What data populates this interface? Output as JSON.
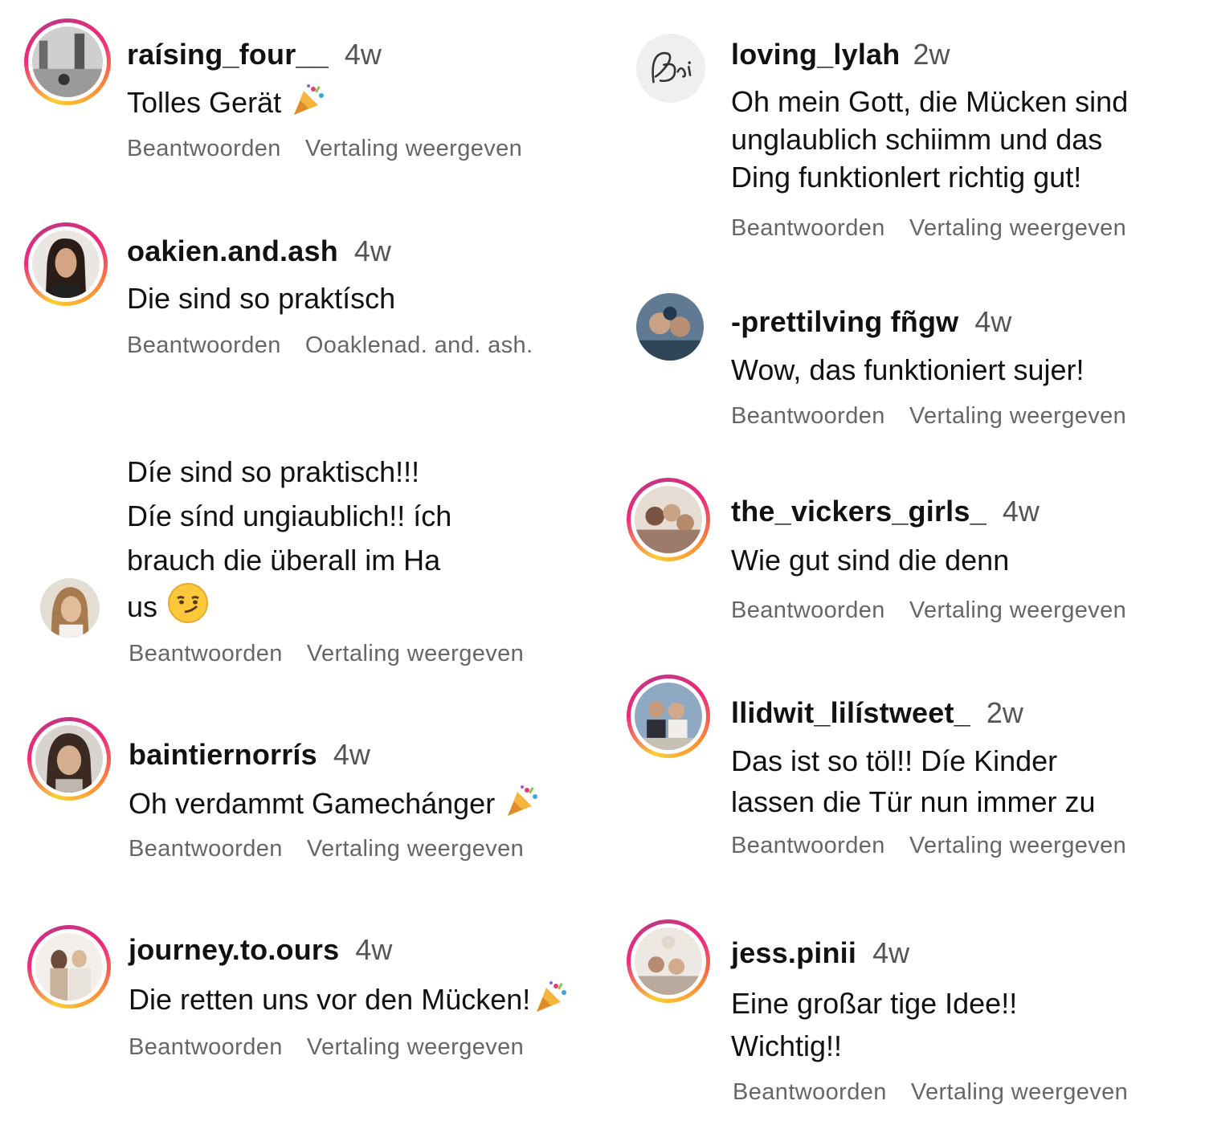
{
  "comments": [
    {
      "username": "raísing_four__",
      "age": "4w",
      "lines": [
        "Tolles Gerät"
      ],
      "reply": "Beantwoorden",
      "translate": "Vertaling weergeven",
      "emoji": "party-popper"
    },
    {
      "username": "oakien.and.ash",
      "age": "4w",
      "lines": [
        "Die sind so praktísch"
      ],
      "reply": "Beantwoorden",
      "translate": "Ooaklenad. and. ash."
    },
    {
      "username": "",
      "age": "",
      "lines": [
        "Díe sind so praktisch!!!",
        "Díe sínd ungiaublich!! ích",
        "brauch die überall im Ha",
        "us"
      ],
      "reply": "Beantwoorden",
      "translate": "Vertaling weergeven",
      "emoji": "smirking-face"
    },
    {
      "username": "baintiernorrís",
      "age": "4w",
      "lines": [
        "Oh verdammt Gamechánger"
      ],
      "reply": "Beantwoorden",
      "translate": "Vertaling weergeven",
      "emoji": "party-popper"
    },
    {
      "username": "journey.to.ours",
      "age": "4w",
      "lines": [
        "Die retten uns vor den Mücken!"
      ],
      "reply": "Beantwoorden",
      "translate": "Vertaling weergeven",
      "emoji": "party-popper"
    },
    {
      "username": "loving_lylah",
      "age": "2w",
      "lines": [
        "Oh mein Gott, die Mücken sind",
        "unglaublich schiimm und das",
        "Ding funktionlert richtig gut!"
      ],
      "reply": "Beantwoorden",
      "translate": "Vertaling weergeven"
    },
    {
      "username": "-prettilving fñgw",
      "age": "4w",
      "lines": [
        "Wow, das funktioniert sujer!"
      ],
      "reply": "Beantwoorden",
      "translate": "Vertaling weergeven"
    },
    {
      "username": "the_vickers_girls_",
      "age": "4w",
      "lines": [
        "Wie gut sind die denn"
      ],
      "reply": "Beantwoorden",
      "translate": "Vertaling weergeven"
    },
    {
      "username": "llidwit_lilístweet_",
      "age": "2w",
      "lines": [
        "Das ist so töl!! Díe Kinder",
        "lassen die Tür nun immer  zu"
      ],
      "reply": "Beantwoorden",
      "translate": "Vertaling weergeven"
    },
    {
      "username": "jess.pinii",
      "age": "4w",
      "lines": [
        "Eine großar tige Idee!!",
        "Wichtig!!"
      ],
      "reply": "Beantwoorden",
      "translate": "Vertaling weergeven"
    }
  ],
  "colors": {
    "ring_start": "#f9ce34",
    "ring_mid": "#ee2a7b",
    "ring_end": "#c13584",
    "text": "#111111",
    "meta": "#666666"
  }
}
